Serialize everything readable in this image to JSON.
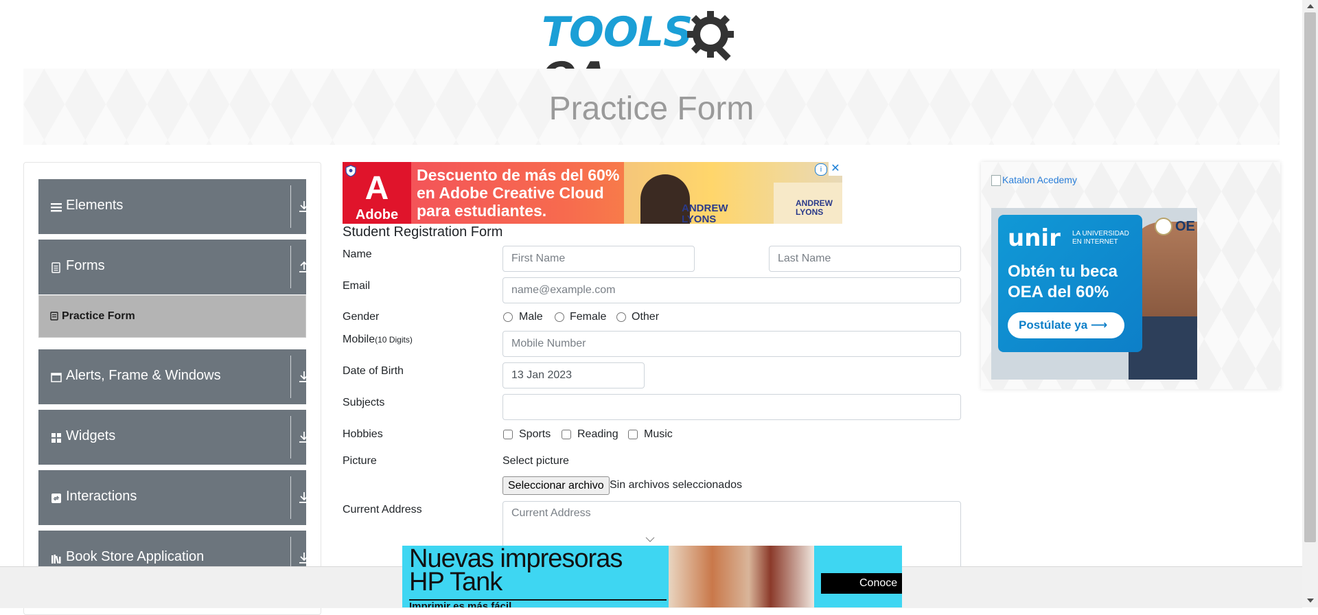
{
  "logo": {
    "part1": "TOOLS",
    "part2": "QA"
  },
  "banner": {
    "title": "Practice Form"
  },
  "sidebar": {
    "groups": [
      {
        "label": "Elements",
        "icon": "hamburger-icon",
        "toggle": "download-arrow-icon"
      },
      {
        "label": "Forms",
        "icon": "document-icon",
        "toggle": "upload-arrow-icon"
      },
      {
        "label": "Alerts, Frame & Windows",
        "icon": "window-icon",
        "toggle": "download-arrow-icon"
      },
      {
        "label": "Widgets",
        "icon": "grid-icon",
        "toggle": "download-arrow-icon"
      },
      {
        "label": "Interactions",
        "icon": "interaction-icon",
        "toggle": "download-arrow-icon"
      },
      {
        "label": "Book Store Application",
        "icon": "books-icon",
        "toggle": "download-arrow-icon"
      }
    ],
    "active_item": {
      "label": "Practice Form",
      "icon": "form-icon"
    }
  },
  "ad_top": {
    "brand": "Adobe",
    "line1": "Descuento de más del 60%",
    "line2": "en Adobe Creative Cloud",
    "line3": "para estudiantes.",
    "name1_a": "ANDREW",
    "name1_b": "LYONS",
    "name2_a": "ANDREW",
    "name2_b": "LYONS",
    "info": "i",
    "close": "✕"
  },
  "form": {
    "title": "Student Registration Form",
    "name_label": "Name",
    "first_name_placeholder": "First Name",
    "last_name_placeholder": "Last Name",
    "email_label": "Email",
    "email_placeholder": "name@example.com",
    "gender_label": "Gender",
    "gender_options": [
      "Male",
      "Female",
      "Other"
    ],
    "mobile_label": "Mobile",
    "mobile_hint": "(10 Digits)",
    "mobile_placeholder": "Mobile Number",
    "dob_label": "Date of Birth",
    "dob_value": "13 Jan 2023",
    "subjects_label": "Subjects",
    "subjects_value": "",
    "hobbies_label": "Hobbies",
    "hobbies_options": [
      "Sports",
      "Reading",
      "Music"
    ],
    "picture_label": "Picture",
    "select_picture": "Select picture",
    "file_button": "Seleccionar archivo",
    "file_status": "Sin archivos seleccionados",
    "address_label": "Current Address",
    "address_placeholder": "Current Address"
  },
  "ad_right": {
    "katalon_alt": "Katalon Acedemy",
    "brand": "unir",
    "brand_sub1": "LA UNIVERSIDAD",
    "brand_sub2": "EN INTERNET",
    "headline1": "Obtén tu beca",
    "headline2": "OEA del 60%",
    "cta": "Postúlate ya ⟶",
    "oe": "OE"
  },
  "ad_bottom": {
    "line1": "Nuevas impresoras",
    "line2": "HP Tank",
    "sub": "Imprimir es más fácil",
    "cta": "Conoce"
  }
}
